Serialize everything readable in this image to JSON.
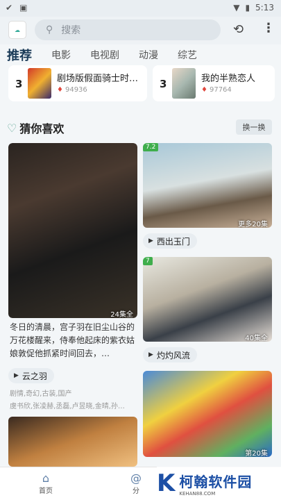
{
  "status_bar": {
    "time": "5:13"
  },
  "search": {
    "placeholder": "搜索"
  },
  "tabs": [
    "推荐",
    "电影",
    "电视剧",
    "动漫",
    "综艺"
  ],
  "hot": [
    {
      "rank": "3",
      "title": "剧场版假面骑士时…",
      "count": "94936"
    },
    {
      "rank": "3",
      "title": "我的半熟恋人",
      "count": "97764"
    }
  ],
  "section": {
    "title": "猜你喜欢",
    "refresh": "换一换"
  },
  "cards": {
    "left1": {
      "ep": "24集全",
      "desc": "冬日的清晨，宫子羽在旧尘山谷的万花楼醒来，侍奉他起床的紫衣姑娘敦促他抓紧时间回去，…",
      "title": "云之羽",
      "tags": "剧情,奇幻,古装,国产",
      "cast": "虞书欣,张凌赫,丞磊,卢昱晓,金晴,孙…"
    },
    "right1": {
      "score": "7.2",
      "ep": "更多20集",
      "title": "西出玉门"
    },
    "right2": {
      "score": "7",
      "ep": "40集全",
      "title": "灼灼风流"
    },
    "right3": {
      "ep": "第20集"
    }
  },
  "nav": {
    "home": "首页",
    "cat": "分"
  },
  "watermark": {
    "name": "柯翰软件园",
    "url": "KEHAN88.COM"
  }
}
